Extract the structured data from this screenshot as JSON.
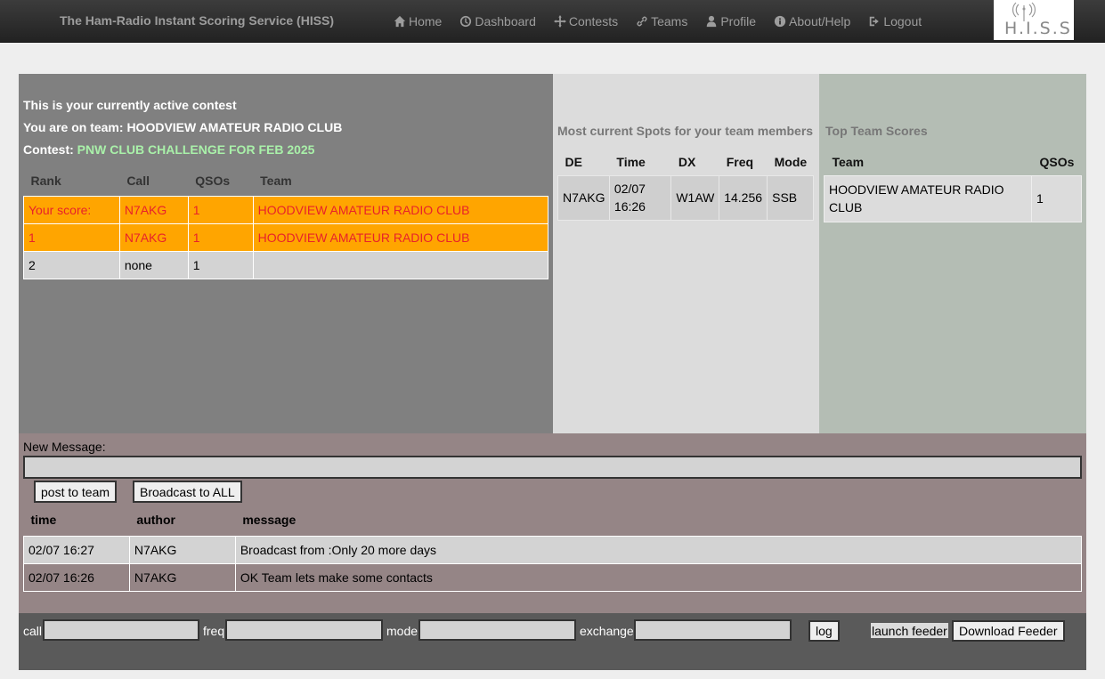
{
  "navbar": {
    "brand": "The Ham-Radio Instant Scoring Service (HISS)",
    "items": [
      {
        "label": "Home",
        "icon": "home-icon"
      },
      {
        "label": "Dashboard",
        "icon": "dashboard-icon"
      },
      {
        "label": "Contests",
        "icon": "contests-icon"
      },
      {
        "label": "Teams",
        "icon": "link-icon"
      },
      {
        "label": "Profile",
        "icon": "user-icon"
      },
      {
        "label": "About/Help",
        "icon": "info-icon"
      },
      {
        "label": "Logout",
        "icon": "logout-icon"
      }
    ],
    "logo_text": "H.I.S.S"
  },
  "contest": {
    "active_text": "This is your currently active contest",
    "team_prefix": "You are on team: ",
    "team_name": "HOODVIEW AMATEUR RADIO CLUB",
    "contest_prefix": "Contest: ",
    "contest_name": "PNW CLUB CHALLENGE FOR FEB 2025"
  },
  "score_table": {
    "headers": [
      "Rank",
      "Call",
      "QSOs",
      "Team"
    ],
    "rows": [
      [
        "Your score:",
        "N7AKG",
        "1",
        "HOODVIEW AMATEUR RADIO CLUB"
      ],
      [
        "1",
        "N7AKG",
        "1",
        "HOODVIEW AMATEUR RADIO CLUB"
      ],
      [
        "2",
        "none",
        "1",
        ""
      ]
    ]
  },
  "spots": {
    "title": "Most current Spots for your team members",
    "headers": [
      "DE",
      "Time",
      "DX",
      "Freq",
      "Mode"
    ],
    "rows": [
      {
        "de": "N7AKG",
        "date": "02/07",
        "time": "16:26",
        "dx": "W1AW",
        "freq": "14.256",
        "mode": "SSB"
      }
    ]
  },
  "top_teams": {
    "title": "Top Team Scores",
    "headers": [
      "Team",
      "QSOs"
    ],
    "rows": [
      {
        "team_line1": "HOODVIEW AMATEUR RADIO",
        "team_line2": "CLUB",
        "qsos": "1"
      }
    ]
  },
  "messages": {
    "new_label": "New Message:",
    "input_value": "",
    "post_label": "post to team",
    "broadcast_label": "Broadcast to ALL",
    "headers": [
      "time",
      "author",
      "message"
    ],
    "rows": [
      [
        "02/07 16:27",
        "N7AKG",
        "Broadcast from :Only 20 more days"
      ],
      [
        "02/07 16:26",
        "N7AKG",
        "OK Team lets make some contacts"
      ]
    ]
  },
  "logger": {
    "call_label": "call",
    "freq_label": "freq",
    "mode_label": "mode",
    "exchange_label": "exchange",
    "log_label": "log",
    "launch_label": "launch feeder",
    "download_label": "Download Feeder"
  }
}
